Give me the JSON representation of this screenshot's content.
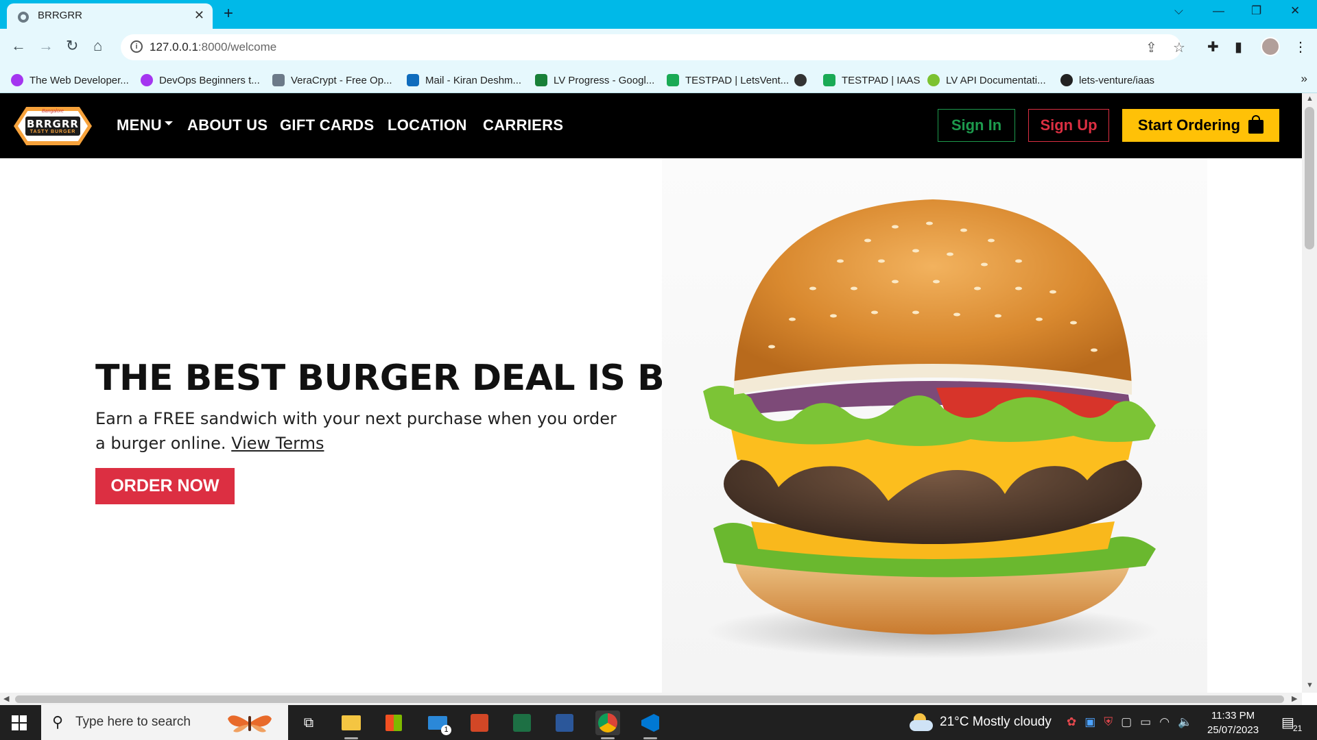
{
  "browser": {
    "tab_title": "BRRGRR",
    "url_host": "127.0.0.1",
    "url_rest": ":8000/welcome",
    "bookmarks": [
      {
        "label": "The Web Developer...",
        "icon": "udemy-icon",
        "color": "#a435f0"
      },
      {
        "label": "DevOps Beginners t...",
        "icon": "udemy-icon",
        "color": "#a435f0"
      },
      {
        "label": "VeraCrypt - Free Op...",
        "icon": "veracrypt-icon",
        "color": "#6c7a89"
      },
      {
        "label": "Mail - Kiran Deshm...",
        "icon": "outlook-icon",
        "color": "#0f6cbd"
      },
      {
        "label": "LV Progress - Googl...",
        "icon": "sheets-icon",
        "color": "#188038"
      },
      {
        "label": "TESTPAD | LetsVent...",
        "icon": "testpad-icon",
        "color": "#1aaa55"
      },
      {
        "label": "",
        "icon": "globe-icon",
        "color": "#333333"
      },
      {
        "label": "TESTPAD | IAAS",
        "icon": "testpad-icon",
        "color": "#1aaa55"
      },
      {
        "label": "LV API Documentati...",
        "icon": "swagger-icon",
        "color": "#7cc230"
      },
      {
        "label": "lets-venture/iaas",
        "icon": "github-icon",
        "color": "#222222"
      }
    ]
  },
  "site": {
    "logo": {
      "top": "Bangalore",
      "word": "BRRGRR",
      "sub": "TASTY BURGER",
      "year": "• 2023 •"
    },
    "nav": [
      "MENU",
      "ABOUT US",
      "GIFT CARDS",
      "LOCATION",
      "CARRIERS"
    ],
    "sign_in": "Sign In",
    "sign_up": "Sign Up",
    "start_ordering": "Start Ordering",
    "hero": {
      "title": "THE BEST BURGER DEAL IS BACK",
      "text": "Earn a FREE sandwich with your next purchase when you order a burger online.",
      "link": "View Terms",
      "cta": "ORDER NOW"
    },
    "colors": {
      "signin": "#1d9a4d",
      "signup": "#dc2f42",
      "order": "#ffc107",
      "cta": "#dc2f42"
    }
  },
  "taskbar": {
    "search_placeholder": "Type here to search",
    "mail_badge": "1",
    "weather": "21°C  Mostly cloudy",
    "time": "11:33 PM",
    "date": "25/07/2023",
    "notifications": "21"
  }
}
